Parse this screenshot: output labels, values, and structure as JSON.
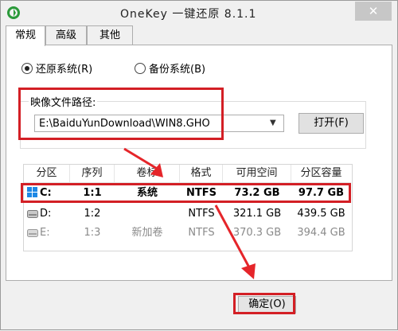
{
  "window": {
    "title": "OneKey 一键还原 8.1.1",
    "close_label": "✕"
  },
  "tabs": [
    {
      "label": "常规"
    },
    {
      "label": "高级"
    },
    {
      "label": "其他"
    }
  ],
  "mode": {
    "restore_label": "还原系统(R)",
    "backup_label": "备份系统(B)",
    "selected": "restore"
  },
  "image_path": {
    "label": "映像文件路径:",
    "value": "E:\\BaiduYunDownload\\WIN8.GHO"
  },
  "open_button": {
    "label": "打开(F)"
  },
  "table": {
    "headers": [
      "分区",
      "序列",
      "卷标",
      "格式",
      "可用空间",
      "分区容量"
    ],
    "rows": [
      {
        "partition": "C:",
        "seq": "1:1",
        "label": "系统",
        "format": "NTFS",
        "free": "73.2 GB",
        "size": "97.7 GB"
      },
      {
        "partition": "D:",
        "seq": "1:2",
        "label": "",
        "format": "NTFS",
        "free": "321.1 GB",
        "size": "439.5 GB"
      },
      {
        "partition": "E:",
        "seq": "1:3",
        "label": "新加卷",
        "format": "NTFS",
        "free": "370.3 GB",
        "size": "394.4 GB"
      }
    ]
  },
  "ok_button": {
    "label": "确定(O)"
  },
  "colors": {
    "highlight": "#d31f25",
    "accent_arrow": "#e5252a",
    "windows_icon_blue": "#1e88e5"
  }
}
